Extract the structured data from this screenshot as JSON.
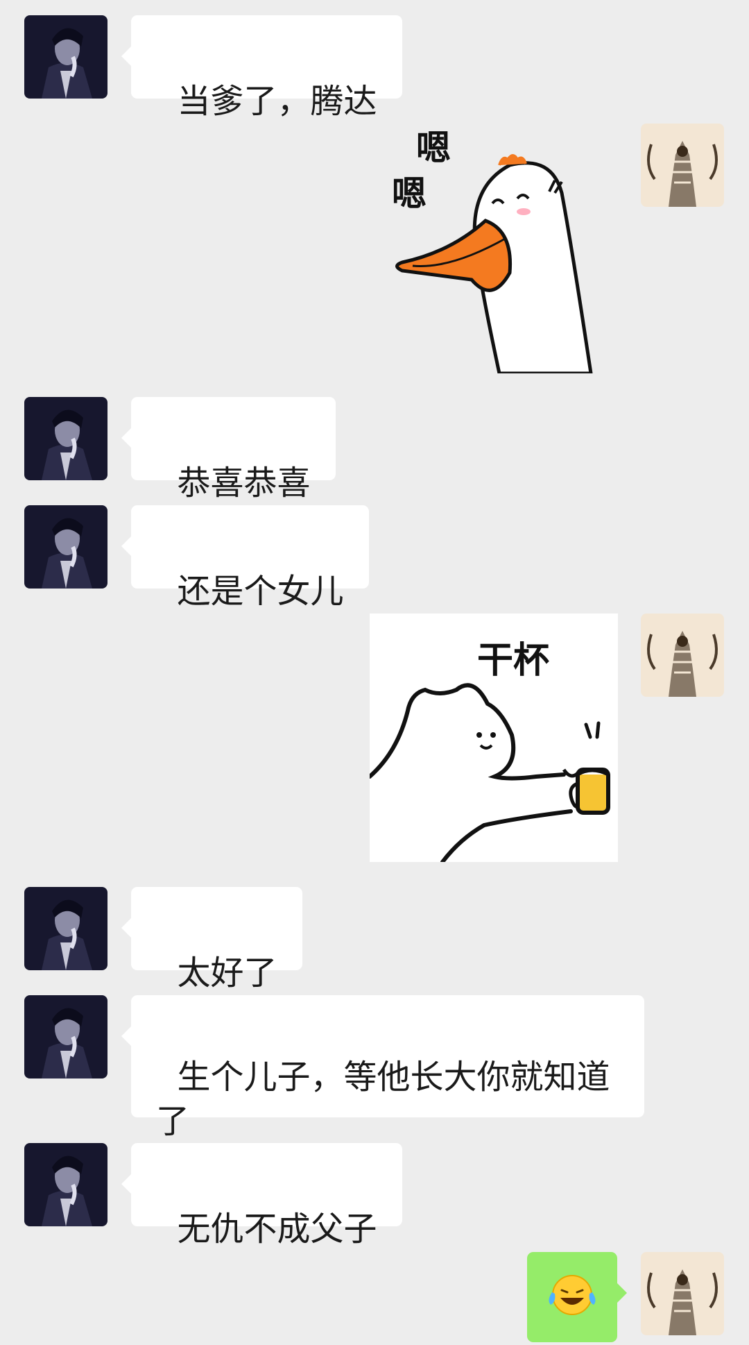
{
  "messages": [
    {
      "id": "m1",
      "side": "left",
      "type": "text",
      "text": "当爹了，腾达"
    },
    {
      "id": "m2",
      "side": "right",
      "type": "sticker",
      "sticker_icon": "goose-nodding-icon",
      "sticker_text": "嗯嗯"
    },
    {
      "id": "m3",
      "side": "left",
      "type": "text",
      "text": "恭喜恭喜"
    },
    {
      "id": "m4",
      "side": "left",
      "type": "text",
      "text": "还是个女儿"
    },
    {
      "id": "m5",
      "side": "right",
      "type": "sticker",
      "sticker_icon": "cat-cheers-beer-icon",
      "sticker_text": "干杯"
    },
    {
      "id": "m6",
      "side": "left",
      "type": "text",
      "text": "太好了"
    },
    {
      "id": "m7",
      "side": "left",
      "type": "text",
      "text": "生个儿子，等他长大你就知道\n了"
    },
    {
      "id": "m8",
      "side": "left",
      "type": "text",
      "text": "无仇不成父子"
    },
    {
      "id": "m9",
      "side": "right",
      "type": "emoji",
      "emoji": "😂"
    }
  ],
  "avatars": {
    "contact": "contact-avatar-icon",
    "self": "self-avatar-icon"
  },
  "colors": {
    "background": "#ededed",
    "bubble_left": "#ffffff",
    "bubble_right": "#95ec69",
    "goose_beak": "#f47a20"
  }
}
